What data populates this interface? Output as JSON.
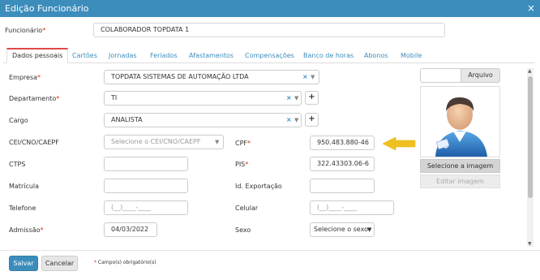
{
  "window": {
    "title": "Edição Funcionário",
    "close_glyph": "×"
  },
  "employee": {
    "label": "Funcionário",
    "required_mark": "*",
    "value": "COLABORADOR TOPDATA 1"
  },
  "tabs": [
    {
      "label": "Dados pessoais",
      "active": true
    },
    {
      "label": "Cartões"
    },
    {
      "label": "Jornadas"
    },
    {
      "label": "Feriados"
    },
    {
      "label": "Afastamentos"
    },
    {
      "label": "Compensações"
    },
    {
      "label": "Banco de horas"
    },
    {
      "label": "Abonos"
    },
    {
      "label": "Mobile"
    }
  ],
  "form": {
    "empresa": {
      "label": "Empresa",
      "required_mark": "*",
      "value": "TOPDATA SISTEMAS DE AUTOMAÇÃO LTDA"
    },
    "departamento": {
      "label": "Departamento",
      "required_mark": "*",
      "value": "TI"
    },
    "cargo": {
      "label": "Cargo",
      "value": "ANALISTA"
    },
    "cei": {
      "label": "CEI/CNO/CAEPF",
      "placeholder": "Selecione o CEI/CNO/CAEPF"
    },
    "cpf": {
      "label": "CPF",
      "required_mark": "*",
      "value": "950.483.880-46"
    },
    "ctps": {
      "label": "CTPS",
      "value": ""
    },
    "pis": {
      "label": "PIS",
      "required_mark": "*",
      "value": "322.43303.06-6"
    },
    "matricula": {
      "label": "Matrícula",
      "value": ""
    },
    "id_exportacao": {
      "label": "Id. Exportação",
      "value": ""
    },
    "telefone": {
      "label": "Telefone",
      "placeholder": "(__)____-____"
    },
    "celular": {
      "label": "Celular",
      "placeholder": "(__)____-____"
    },
    "admissao": {
      "label": "Admissão",
      "required_mark": "*",
      "value": "04/03/2022"
    },
    "sexo": {
      "label": "Sexo",
      "placeholder": "Selecione o sexo"
    }
  },
  "photo": {
    "file_button": "Arquivo",
    "select_button": "Selecione a imagem",
    "edit_button": "Editar imagem"
  },
  "footer": {
    "save": "Salvar",
    "cancel": "Cancelar",
    "required_note": "* Campo(s) obrigatório(s)"
  },
  "colors": {
    "primary": "#3c8dbc",
    "required": "#dd2c00",
    "arrow": "#f0c020",
    "active_tab_border": "#e04a4a"
  },
  "icons": {
    "clear": "×",
    "dropdown": "chevron-down",
    "add": "+",
    "pointer": "arrow-left"
  }
}
